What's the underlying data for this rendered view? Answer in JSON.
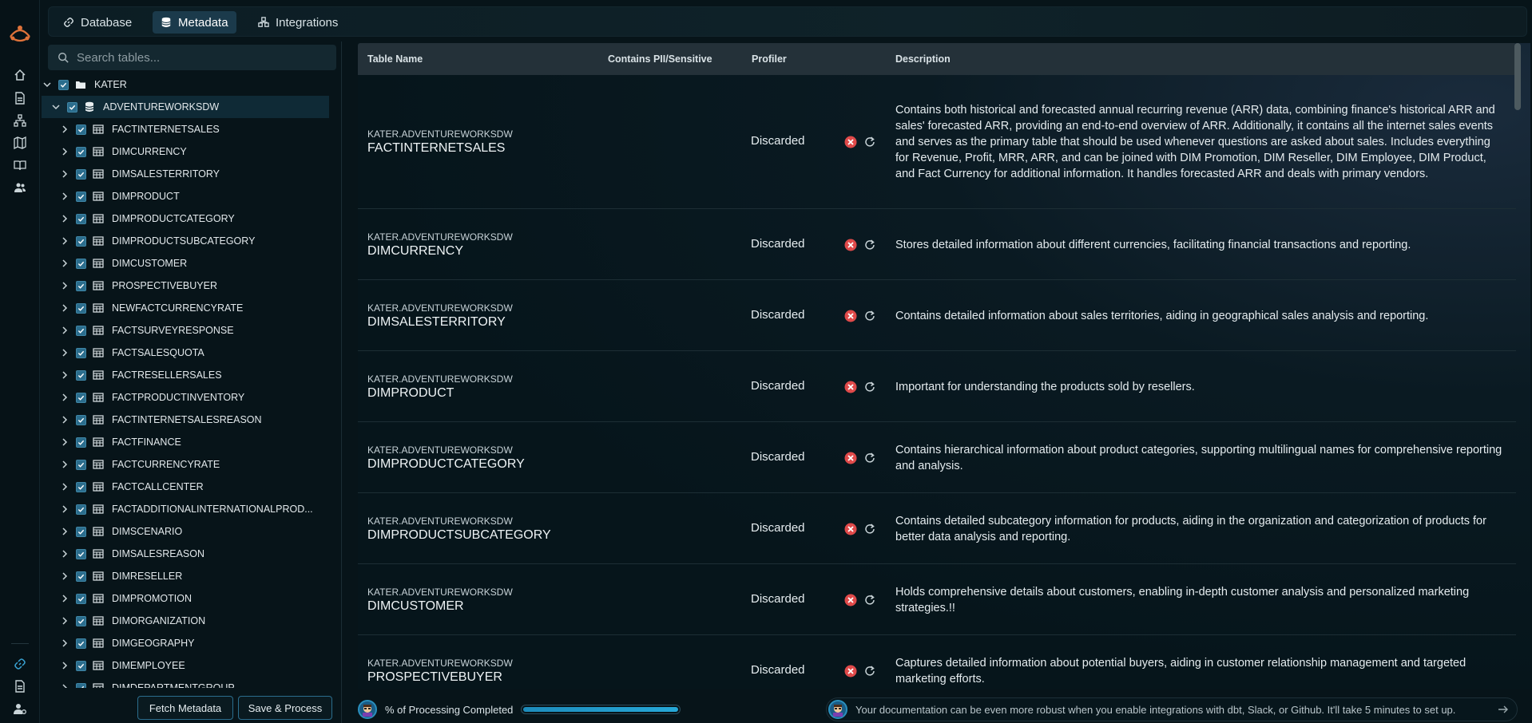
{
  "tabs": [
    {
      "label": "Database",
      "icon": "link-icon",
      "active": false
    },
    {
      "label": "Metadata",
      "icon": "database-icon",
      "active": true
    },
    {
      "label": "Integrations",
      "icon": "integrations-icon",
      "active": false
    }
  ],
  "rail": {
    "icons": [
      "logo-icon",
      "home-icon",
      "document-icon",
      "hierarchy-icon",
      "map-icon",
      "book-icon",
      "users-icon",
      "link-icon",
      "file-icon",
      "user-settings-icon"
    ]
  },
  "search": {
    "placeholder": "Search tables..."
  },
  "tree": {
    "root": "KATER",
    "schema": "ADVENTUREWORKSDW",
    "tables": [
      "FACTINTERNETSALES",
      "DIMCURRENCY",
      "DIMSALESTERRITORY",
      "DIMPRODUCT",
      "DIMPRODUCTCATEGORY",
      "DIMPRODUCTSUBCATEGORY",
      "DIMCUSTOMER",
      "PROSPECTIVEBUYER",
      "NEWFACTCURRENCYRATE",
      "FACTSURVEYRESPONSE",
      "FACTSALESQUOTA",
      "FACTRESELLERSALES",
      "FACTPRODUCTINVENTORY",
      "FACTINTERNETSALESREASON",
      "FACTFINANCE",
      "FACTCURRENCYRATE",
      "FACTCALLCENTER",
      "FACTADDITIONALINTERNATIONALPROD...",
      "DIMSCENARIO",
      "DIMSALESREASON",
      "DIMRESELLER",
      "DIMPROMOTION",
      "DIMORGANIZATION",
      "DIMGEOGRAPHY",
      "DIMEMPLOYEE",
      "DIMDEPARTMENTGROUP"
    ]
  },
  "buttons": {
    "fetch": "Fetch Metadata",
    "save": "Save & Process"
  },
  "table": {
    "headers": {
      "name": "Table Name",
      "pii": "Contains PII/Sensitive",
      "profiler": "Profiler",
      "description": "Description"
    },
    "rows": [
      {
        "schema": "KATER.ADVENTUREWORKSDW",
        "name": "FACTINTERNETSALES",
        "profiler": "Discarded",
        "description": "Contains both historical and forecasted annual recurring revenue (ARR) data, combining finance's historical ARR and sales' forecasted ARR, providing an end-to-end overview of ARR. Additionally, it contains all the internet sales events and serves as the primary table that should be used whenever questions are asked about sales. Includes everything for Revenue, Profit, MRR, ARR, and can be joined with DIM Promotion, DIM Reseller, DIM Employee, DIM Product, and Fact Currency for additional information. It handles forecasted ARR and deals with primary vendors."
      },
      {
        "schema": "KATER.ADVENTUREWORKSDW",
        "name": "DIMCURRENCY",
        "profiler": "Discarded",
        "description": "Stores detailed information about different currencies, facilitating financial transactions and reporting."
      },
      {
        "schema": "KATER.ADVENTUREWORKSDW",
        "name": "DIMSALESTERRITORY",
        "profiler": "Discarded",
        "description": "Contains detailed information about sales territories, aiding in geographical sales analysis and reporting."
      },
      {
        "schema": "KATER.ADVENTUREWORKSDW",
        "name": "DIMPRODUCT",
        "profiler": "Discarded",
        "description": "Important for understanding the products sold by resellers."
      },
      {
        "schema": "KATER.ADVENTUREWORKSDW",
        "name": "DIMPRODUCTCATEGORY",
        "profiler": "Discarded",
        "description": "Contains hierarchical information about product categories, supporting multilingual names for comprehensive reporting and analysis."
      },
      {
        "schema": "KATER.ADVENTUREWORKSDW",
        "name": "DIMPRODUCTSUBCATEGORY",
        "profiler": "Discarded",
        "description": "Contains detailed subcategory information for products, aiding in the organization and categorization of products for better data analysis and reporting."
      },
      {
        "schema": "KATER.ADVENTUREWORKSDW",
        "name": "DIMCUSTOMER",
        "profiler": "Discarded",
        "description": "Holds comprehensive details about customers, enabling in-depth customer analysis and personalized marketing strategies.!!"
      },
      {
        "schema": "KATER.ADVENTUREWORKSDW",
        "name": "PROSPECTIVEBUYER",
        "profiler": "Discarded",
        "description": "Captures detailed information about potential buyers, aiding in customer relationship management and targeted marketing efforts."
      }
    ]
  },
  "status": {
    "progress_label": "% of Processing Completed",
    "progress_fraction": 1.0,
    "notice": "Your documentation can be even more robust when you enable integrations with dbt, Slack, or Github. It'll take 5 minutes to set up."
  },
  "colors": {
    "accent": "#2b6d8d",
    "active_tab": "#1b3a4b",
    "error": "#e04a4a",
    "brand": "#e0733a"
  }
}
